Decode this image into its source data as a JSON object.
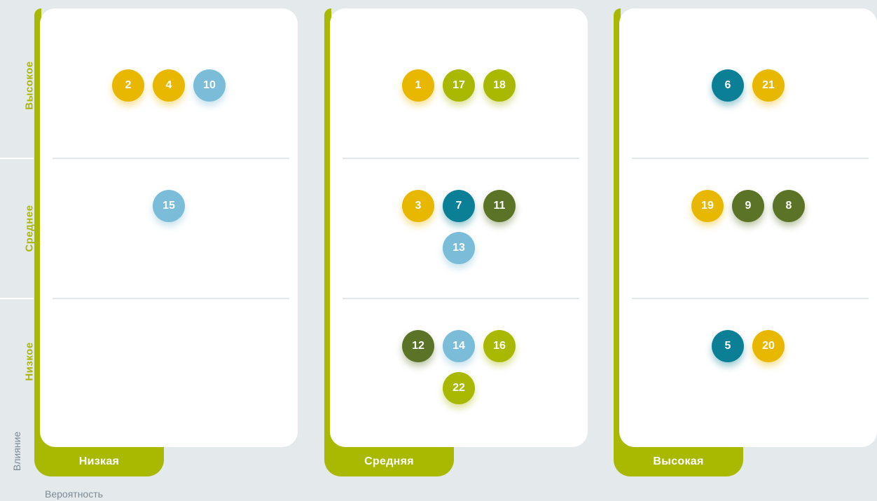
{
  "y_axis": {
    "label": "Влияние",
    "levels": [
      "Высокое",
      "Среднее",
      "Низкое"
    ]
  },
  "x_axis": {
    "label": "Вероятность",
    "levels": [
      "Низкая",
      "Средняя",
      "Высокая"
    ]
  },
  "colors": {
    "yellow": "#e8b800",
    "lime": "#a9b800",
    "teal": "#0a7f96",
    "olive": "#5a7326",
    "lightblue": "#7bbcd8"
  },
  "matrix": [
    {
      "probability": "Низкая",
      "cells": [
        [
          {
            "id": "2",
            "color": "yellow"
          },
          {
            "id": "4",
            "color": "yellow"
          },
          {
            "id": "10",
            "color": "lightblue"
          }
        ],
        [
          {
            "id": "15",
            "color": "lightblue"
          }
        ],
        []
      ]
    },
    {
      "probability": "Средняя",
      "cells": [
        [
          {
            "id": "1",
            "color": "yellow"
          },
          {
            "id": "17",
            "color": "lime"
          },
          {
            "id": "18",
            "color": "lime"
          }
        ],
        [
          {
            "id": "3",
            "color": "yellow"
          },
          {
            "id": "7",
            "color": "teal"
          },
          {
            "id": "11",
            "color": "olive"
          },
          {
            "id": "13",
            "color": "lightblue"
          }
        ],
        [
          {
            "id": "12",
            "color": "olive"
          },
          {
            "id": "14",
            "color": "lightblue"
          },
          {
            "id": "16",
            "color": "lime"
          },
          {
            "id": "22",
            "color": "lime"
          }
        ]
      ]
    },
    {
      "probability": "Высокая",
      "cells": [
        [
          {
            "id": "6",
            "color": "teal"
          },
          {
            "id": "21",
            "color": "yellow"
          }
        ],
        [
          {
            "id": "19",
            "color": "yellow"
          },
          {
            "id": "9",
            "color": "olive"
          },
          {
            "id": "8",
            "color": "olive"
          }
        ],
        [
          {
            "id": "5",
            "color": "teal"
          },
          {
            "id": "20",
            "color": "yellow"
          }
        ]
      ]
    }
  ]
}
